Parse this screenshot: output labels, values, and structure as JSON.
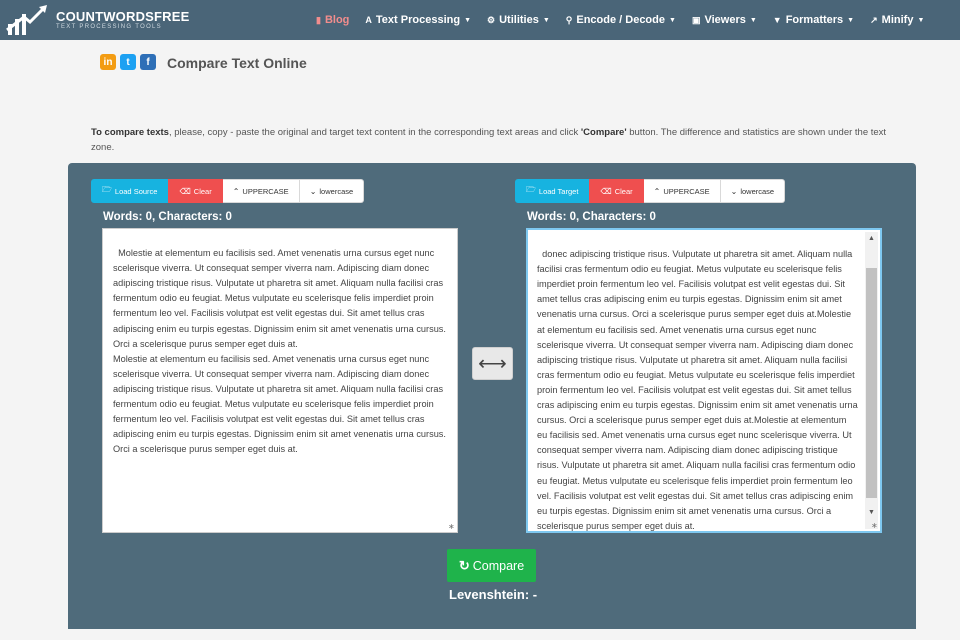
{
  "header": {
    "logo_title": "COUNTWORDSFREE",
    "logo_subtitle": "TEXT PROCESSING TOOLS",
    "nav": [
      {
        "label": "Blog",
        "icon": "book-icon"
      },
      {
        "label": "Text Processing",
        "icon": "font-icon"
      },
      {
        "label": "Utilities",
        "icon": "gear-icon"
      },
      {
        "label": "Encode / Decode",
        "icon": "key-icon"
      },
      {
        "label": "Viewers",
        "icon": "window-icon"
      },
      {
        "label": "Formatters",
        "icon": "tools-icon"
      },
      {
        "label": "Minify",
        "icon": "compress-icon"
      }
    ]
  },
  "socials": [
    "in",
    "t",
    "f"
  ],
  "page_title": "Compare Text Online",
  "intro": {
    "bold1": "To compare texts",
    "text1": ", please, copy - paste the original and target text content in the corresponding text areas and click ",
    "bold2": "'Compare'",
    "text2": " button. The difference and statistics are shown under the text zone."
  },
  "source": {
    "load_label": "Load Source",
    "clear_label": "Clear",
    "upper_label": "UPPERCASE",
    "lower_label": "lowercase",
    "counts": {
      "words_label": "Words: ",
      "words": "0",
      "chars_label": ", Characters: ",
      "chars": "0"
    },
    "text": "Molestie at elementum eu facilisis sed. Amet venenatis urna cursus eget nunc scelerisque viverra. Ut consequat semper viverra nam. Adipiscing diam donec adipiscing tristique risus. Vulputate ut pharetra sit amet. Aliquam nulla facilisi cras fermentum odio eu feugiat. Metus vulputate eu scelerisque felis imperdiet proin fermentum leo vel. Facilisis volutpat est velit egestas dui. Sit amet tellus cras adipiscing enim eu turpis egestas. Dignissim enim sit amet venenatis urna cursus. Orci a scelerisque purus semper eget duis at.\nMolestie at elementum eu facilisis sed. Amet venenatis urna cursus eget nunc scelerisque viverra. Ut consequat semper viverra nam. Adipiscing diam donec adipiscing tristique risus. Vulputate ut pharetra sit amet. Aliquam nulla facilisi cras fermentum odio eu feugiat. Metus vulputate eu scelerisque felis imperdiet proin fermentum leo vel. Facilisis volutpat est velit egestas dui. Sit amet tellus cras adipiscing enim eu turpis egestas. Dignissim enim sit amet venenatis urna cursus. Orci a scelerisque purus semper eget duis at."
  },
  "target": {
    "load_label": "Load Target",
    "clear_label": "Clear",
    "upper_label": "UPPERCASE",
    "lower_label": "lowercase",
    "counts": {
      "words_label": "Words: ",
      "words": "0",
      "chars_label": ", Characters: ",
      "chars": "0"
    },
    "text": "donec adipiscing tristique risus. Vulputate ut pharetra sit amet. Aliquam nulla facilisi cras fermentum odio eu feugiat. Metus vulputate eu scelerisque felis imperdiet proin fermentum leo vel. Facilisis volutpat est velit egestas dui. Sit amet tellus cras adipiscing enim eu turpis egestas. Dignissim enim sit amet venenatis urna cursus. Orci a scelerisque purus semper eget duis at.Molestie at elementum eu facilisis sed. Amet venenatis urna cursus eget nunc scelerisque viverra. Ut consequat semper viverra nam. Adipiscing diam donec adipiscing tristique risus. Vulputate ut pharetra sit amet. Aliquam nulla facilisi cras fermentum odio eu feugiat. Metus vulputate eu scelerisque felis imperdiet proin fermentum leo vel. Facilisis volutpat est velit egestas dui. Sit amet tellus cras adipiscing enim eu turpis egestas. Dignissim enim sit amet venenatis urna cursus. Orci a scelerisque purus semper eget duis at.Molestie at elementum eu facilisis sed. Amet venenatis urna cursus eget nunc scelerisque viverra. Ut consequat semper viverra nam. Adipiscing diam donec adipiscing tristique risus. Vulputate ut pharetra sit amet. Aliquam nulla facilisi cras fermentum odio eu feugiat. Metus vulputate eu scelerisque felis imperdiet proin fermentum leo vel. Facilisis volutpat est velit egestas dui. Sit amet tellus cras adipiscing enim eu turpis egestas. Dignissim enim sit amet venenatis urna cursus. Orci a scelerisque purus semper eget duis at."
  },
  "compare_label": "Compare",
  "levenshtein": "Levenshtein: -",
  "colors": {
    "nav_bg": "#4a6578",
    "panel_bg": "#4f6b7b",
    "load": "#17b3e0",
    "clear": "#ef4f4f",
    "compare": "#1fb34b",
    "blog": "#f28d8d"
  }
}
